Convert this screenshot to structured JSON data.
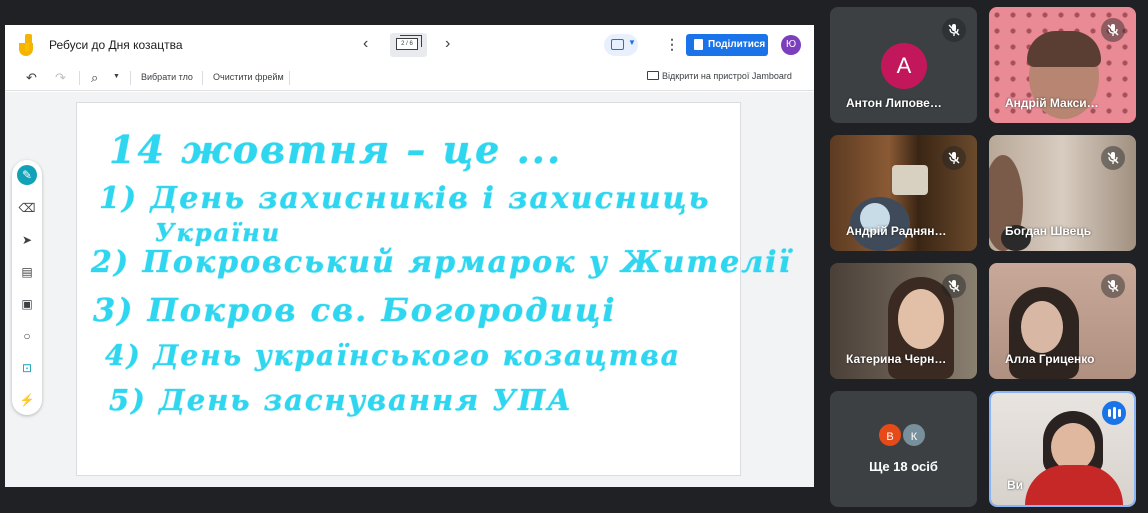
{
  "jamboard": {
    "title": "Ребуси до Дня козацтва",
    "frame_counter": "2 / 6",
    "share_label": "Поділитися",
    "user_initial": "Ю",
    "toolbar": {
      "set_background": "Вибрати тло",
      "clear_frame": "Очистити фрейм",
      "open_on_device": "Відкрити на пристрої Jamboard"
    },
    "handwriting": [
      "14 жовтня – це ...",
      "1) День захисників і захисниць",
      "України",
      "2) Покровський ярмарок у Жителії",
      "3) Покров св. Богородиці",
      "4) День українського козацтва",
      "5) День заснування УПА"
    ],
    "ink_color": "#2ed6f0",
    "accent_color": "#1a73e8"
  },
  "participants": [
    {
      "name": "Антон Липове…",
      "initial": "А",
      "muted": true,
      "type": "avatar",
      "avatar_color": "#c2185b"
    },
    {
      "name": "Андрій Макси…",
      "muted": true,
      "type": "video"
    },
    {
      "name": "Андрій Раднян…",
      "muted": true,
      "type": "video"
    },
    {
      "name": "Богдан Швець",
      "muted": true,
      "type": "video"
    },
    {
      "name": "Катерина Черн…",
      "muted": true,
      "type": "video"
    },
    {
      "name": "Алла Гриценко",
      "muted": true,
      "type": "video"
    }
  ],
  "more": {
    "label": "Ще 18 осіб",
    "initials": [
      "В",
      "К"
    ],
    "colors": [
      "#e64a19",
      "#78909c"
    ]
  },
  "self": {
    "name": "Ви",
    "speaking": true
  }
}
